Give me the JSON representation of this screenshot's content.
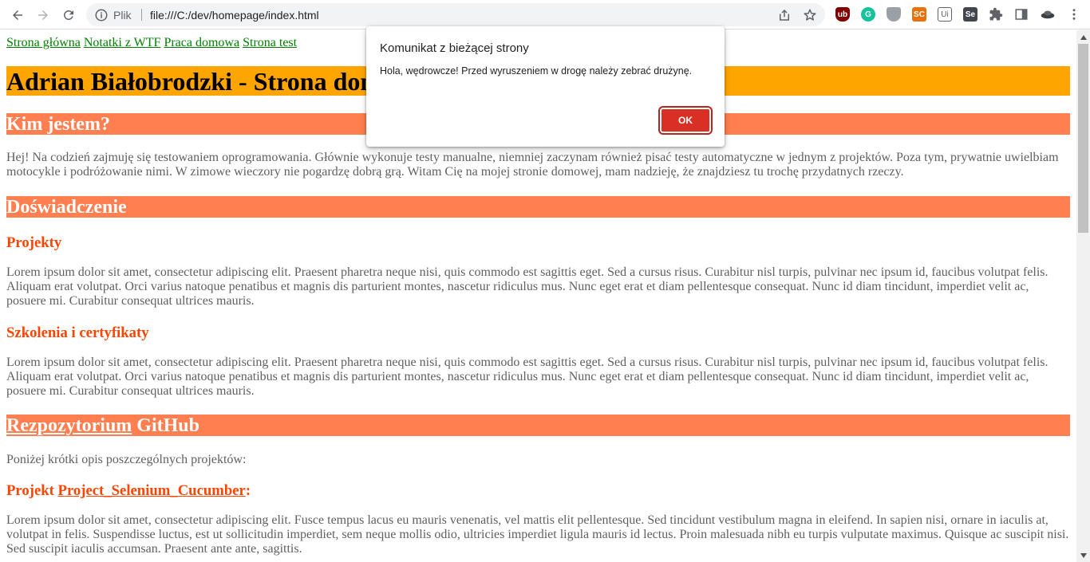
{
  "browser": {
    "scheme_label": "Plik",
    "url": "file:///C:/dev/homepage/index.html",
    "extensions": [
      {
        "name": "ublock-icon",
        "label": "ub",
        "color": "#800000"
      },
      {
        "name": "grammarly-icon",
        "label": "G",
        "color": "#15c39a"
      },
      {
        "name": "shield-extension-icon",
        "label": "",
        "color": "#9aa0a6"
      },
      {
        "name": "selectorshub-icon",
        "label": "SC",
        "color": "#e8710a"
      },
      {
        "name": "ui-extension-icon",
        "label": "Ui",
        "color": "#ffffff"
      },
      {
        "name": "selenium-ide-icon",
        "label": "Se",
        "color": "#43474d"
      }
    ]
  },
  "nav": {
    "links": [
      "Strona główna",
      "Notatki z WTF",
      "Praca domowa",
      "Strona test"
    ]
  },
  "site_title": "Adrian Białobrodzki - Strona dom",
  "sections": {
    "about_heading": "Kim jestem?",
    "about_text": "Hej! Na codzień zajmuję się testowaniem oprogramowania. Głównie wykonuje testy manualne, niemniej zaczynam również pisać testy automatyczne w jednym z projektów. Poza tym, prywatnie uwielbiam motocykle i podróżowanie nimi. W zimowe wieczory nie pogardzę dobrą grą. Witam Cię na mojej stronie domowej, mam nadzieję, że znajdziesz tu trochę przydatnych rzeczy.",
    "experience_heading": "Doświadczenie",
    "projects_heading": "Projekty",
    "projects_text": "Lorem ipsum dolor sit amet, consectetur adipiscing elit. Praesent pharetra neque nisi, quis commodo est sagittis eget. Sed a cursus risus. Curabitur nisl turpis, pulvinar nec ipsum id, faucibus volutpat felis. Aliquam erat volutpat. Orci varius natoque penatibus et magnis dis parturient montes, nascetur ridiculus mus. Nunc eget erat et diam pellentesque consequat. Nunc id diam tincidunt, imperdiet velit ac, posuere mi. Curabitur consequat ultrices mauris.",
    "trainings_heading": "Szkolenia i certyfikaty",
    "trainings_text": "Lorem ipsum dolor sit amet, consectetur adipiscing elit. Praesent pharetra neque nisi, quis commodo est sagittis eget. Sed a cursus risus. Curabitur nisl turpis, pulvinar nec ipsum id, faucibus volutpat felis. Aliquam erat volutpat. Orci varius natoque penatibus et magnis dis parturient montes, nascetur ridiculus mus. Nunc eget erat et diam pellentesque consequat. Nunc id diam tincidunt, imperdiet velit ac, posuere mi. Curabitur consequat ultrices mauris.",
    "repo_heading_link": "Rezpozytorium",
    "repo_heading_rest": " GitHub",
    "repo_intro": "Poniżej krótki opis poszczególnych projektów:",
    "project1_prefix": "Projekt ",
    "project1_link": "Project_Selenium_Cucumber",
    "project1_suffix": ":",
    "project1_text": "Lorem ipsum dolor sit amet, consectetur adipiscing elit. Fusce tempus lacus eu mauris venenatis, vel mattis elit pellentesque. Sed tincidunt vestibulum magna in eleifend. In sapien nisi, ornare in iaculis at, volutpat in felis. Suspendisse luctus, est ut sollicitudin imperdiet, sem neque mollis odio, ultricies imperdiet ligula mauris id lectus. Proin malesuada nibh eu turpis vulputate maximus. Quisque ac suscipit nisi. Sed suscipit iaculis accumsan. Praesent ante ante, sagittis."
  },
  "dialog": {
    "title": "Komunikat z bieżącej strony",
    "message": "Hola, wędrowcze! Przed wyruszeniem w drogę należy zebrać drużynę.",
    "ok_label": "OK"
  },
  "colors": {
    "title_bg": "#ffa500",
    "heading_bg": "#ff7f50",
    "subheading": "#ff4500",
    "nav_link": "#008000",
    "dialog_ok": "#d93025"
  }
}
